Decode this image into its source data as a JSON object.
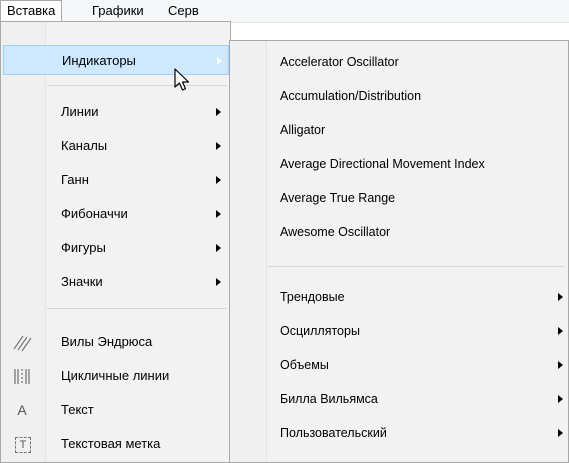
{
  "menubar": {
    "items": [
      "Вставка",
      "Графики",
      "Серв"
    ]
  },
  "insert_menu": {
    "items": [
      {
        "label": "Индикаторы",
        "submenu": true,
        "highlighted": true
      },
      {
        "label": "Линии",
        "submenu": true
      },
      {
        "label": "Каналы",
        "submenu": true
      },
      {
        "label": "Ганн",
        "submenu": true
      },
      {
        "label": "Фибоначчи",
        "submenu": true
      },
      {
        "label": "Фигуры",
        "submenu": true
      },
      {
        "label": "Значки",
        "submenu": true
      },
      {
        "label": "Вилы Эндрюса",
        "icon": "andrews-pitchfork-icon"
      },
      {
        "label": "Цикличные линии",
        "icon": "cycle-lines-icon"
      },
      {
        "label": "Текст",
        "icon": "text-icon",
        "icon_text": "A"
      },
      {
        "label": "Текстовая метка",
        "icon": "text-label-icon",
        "icon_text": "T"
      }
    ]
  },
  "indicators_submenu": {
    "items": [
      {
        "label": "Accelerator Oscillator"
      },
      {
        "label": "Accumulation/Distribution"
      },
      {
        "label": "Alligator"
      },
      {
        "label": "Average Directional Movement Index"
      },
      {
        "label": "Average True Range"
      },
      {
        "label": "Awesome Oscillator"
      },
      {
        "label": "Трендовые",
        "submenu": true
      },
      {
        "label": "Осцилляторы",
        "submenu": true
      },
      {
        "label": "Объемы",
        "submenu": true
      },
      {
        "label": "Билла Вильямса",
        "submenu": true
      },
      {
        "label": "Пользовательский",
        "submenu": true
      }
    ]
  },
  "colors": {
    "highlight_bg": "#cde8ff",
    "highlight_border": "#99d1ff",
    "menu_bg": "#f2f2f2",
    "menu_border": "#a9a9a9"
  }
}
